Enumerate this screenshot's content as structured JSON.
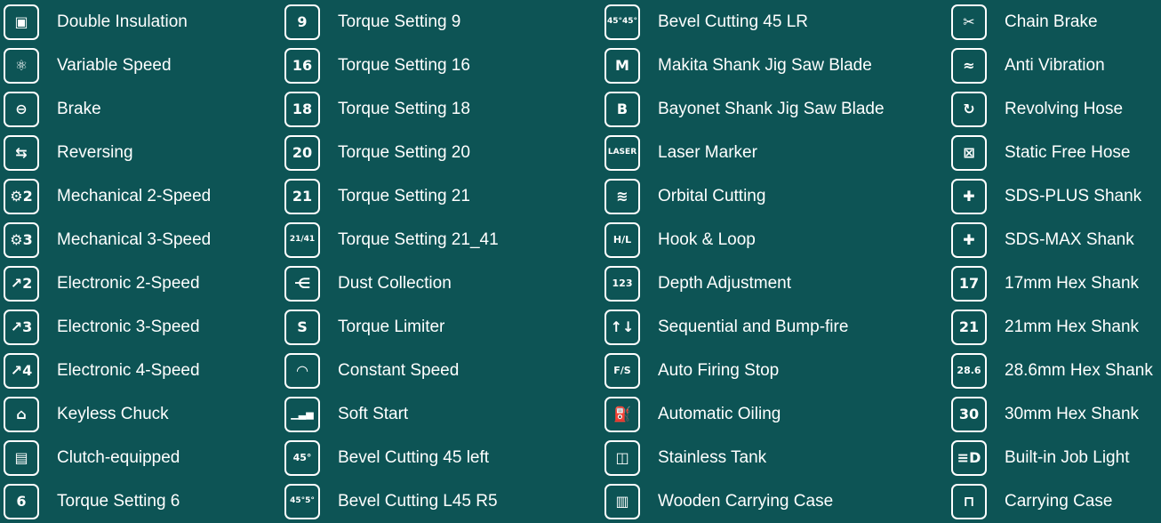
{
  "colors": {
    "background": "#0d5455",
    "foreground": "#ffffff"
  },
  "columns": [
    {
      "items": [
        {
          "label": "Double Insulation",
          "icon": "double-square-icon",
          "glyph": "▣"
        },
        {
          "label": "Variable Speed",
          "icon": "variable-speed-icon",
          "glyph": "⚛"
        },
        {
          "label": "Brake",
          "icon": "brake-icon",
          "glyph": "⊖"
        },
        {
          "label": "Reversing",
          "icon": "reversing-icon",
          "glyph": "⇆"
        },
        {
          "label": "Mechanical 2-Speed",
          "icon": "gear-2-icon",
          "glyph": "⚙2"
        },
        {
          "label": "Mechanical 3-Speed",
          "icon": "gear-3-icon",
          "glyph": "⚙3"
        },
        {
          "label": "Electronic 2-Speed",
          "icon": "electronic-2-icon",
          "glyph": "↗2"
        },
        {
          "label": "Electronic 3-Speed",
          "icon": "electronic-3-icon",
          "glyph": "↗3"
        },
        {
          "label": "Electronic 4-Speed",
          "icon": "electronic-4-icon",
          "glyph": "↗4"
        },
        {
          "label": "Keyless Chuck",
          "icon": "keyless-chuck-icon",
          "glyph": "⌂"
        },
        {
          "label": "Clutch-equipped",
          "icon": "clutch-icon",
          "glyph": "▤"
        },
        {
          "label": "Torque Setting 6",
          "icon": "torque-6-icon",
          "glyph": "6"
        }
      ]
    },
    {
      "items": [
        {
          "label": "Torque Setting 9",
          "icon": "torque-9-icon",
          "glyph": "9"
        },
        {
          "label": "Torque Setting 16",
          "icon": "torque-16-icon",
          "glyph": "16"
        },
        {
          "label": "Torque Setting 18",
          "icon": "torque-18-icon",
          "glyph": "18"
        },
        {
          "label": "Torque Setting 20",
          "icon": "torque-20-icon",
          "glyph": "20"
        },
        {
          "label": "Torque Setting 21",
          "icon": "torque-21-icon",
          "glyph": "21"
        },
        {
          "label": "Torque Setting 21_41",
          "icon": "torque-21-41-icon",
          "glyph": "21/41"
        },
        {
          "label": "Dust Collection",
          "icon": "dust-collection-icon",
          "glyph": "⋲"
        },
        {
          "label": "Torque Limiter",
          "icon": "torque-limiter-icon",
          "glyph": "S"
        },
        {
          "label": "Constant Speed",
          "icon": "constant-speed-icon",
          "glyph": "◠"
        },
        {
          "label": "Soft Start",
          "icon": "soft-start-icon",
          "glyph": "▁▃▅"
        },
        {
          "label": "Bevel Cutting 45 left",
          "icon": "bevel-45-left-icon",
          "glyph": "45°"
        },
        {
          "label": "Bevel Cutting L45 R5",
          "icon": "bevel-l45-r5-icon",
          "glyph": "45°5°"
        }
      ]
    },
    {
      "items": [
        {
          "label": "Bevel Cutting 45 LR",
          "icon": "bevel-45-lr-icon",
          "glyph": "45°45°"
        },
        {
          "label": "Makita Shank Jig Saw Blade",
          "icon": "makita-shank-blade-icon",
          "glyph": "M"
        },
        {
          "label": "Bayonet Shank Jig Saw Blade",
          "icon": "bayonet-shank-blade-icon",
          "glyph": "B"
        },
        {
          "label": "Laser Marker",
          "icon": "laser-marker-icon",
          "glyph": "LASER"
        },
        {
          "label": "Orbital Cutting",
          "icon": "orbital-cutting-icon",
          "glyph": "≋"
        },
        {
          "label": "Hook & Loop",
          "icon": "hook-loop-icon",
          "glyph": "H/L"
        },
        {
          "label": "Depth Adjustment",
          "icon": "depth-adjustment-icon",
          "glyph": "123"
        },
        {
          "label": "Sequential and Bump-fire",
          "icon": "sequential-bump-icon",
          "glyph": "↑↓"
        },
        {
          "label": "Auto Firing Stop",
          "icon": "auto-firing-stop-icon",
          "glyph": "F/S"
        },
        {
          "label": "Automatic Oiling",
          "icon": "automatic-oiling-icon",
          "glyph": "⛽"
        },
        {
          "label": "Stainless Tank",
          "icon": "stainless-tank-icon",
          "glyph": "◫"
        },
        {
          "label": "Wooden Carrying Case",
          "icon": "wooden-case-icon",
          "glyph": "▥"
        }
      ]
    },
    {
      "items": [
        {
          "label": "Chain Brake",
          "icon": "chain-brake-icon",
          "glyph": "✂"
        },
        {
          "label": "Anti Vibration",
          "icon": "anti-vibration-icon",
          "glyph": "≈"
        },
        {
          "label": "Revolving Hose",
          "icon": "revolving-hose-icon",
          "glyph": "↻"
        },
        {
          "label": "Static Free Hose",
          "icon": "static-free-hose-icon",
          "glyph": "⊠"
        },
        {
          "label": "SDS-PLUS Shank",
          "icon": "sds-plus-icon",
          "glyph": "✚"
        },
        {
          "label": "SDS-MAX Shank",
          "icon": "sds-max-icon",
          "glyph": "✚"
        },
        {
          "label": "17mm Hex Shank",
          "icon": "hex-17-icon",
          "glyph": "17"
        },
        {
          "label": "21mm Hex Shank",
          "icon": "hex-21-icon",
          "glyph": "21"
        },
        {
          "label": "28.6mm Hex Shank",
          "icon": "hex-28-6-icon",
          "glyph": "28.6"
        },
        {
          "label": "30mm Hex Shank",
          "icon": "hex-30-icon",
          "glyph": "30"
        },
        {
          "label": "Built-in Job Light",
          "icon": "job-light-icon",
          "glyph": "≡D"
        },
        {
          "label": "Carrying Case",
          "icon": "carrying-case-icon",
          "glyph": "⊓"
        }
      ]
    }
  ]
}
